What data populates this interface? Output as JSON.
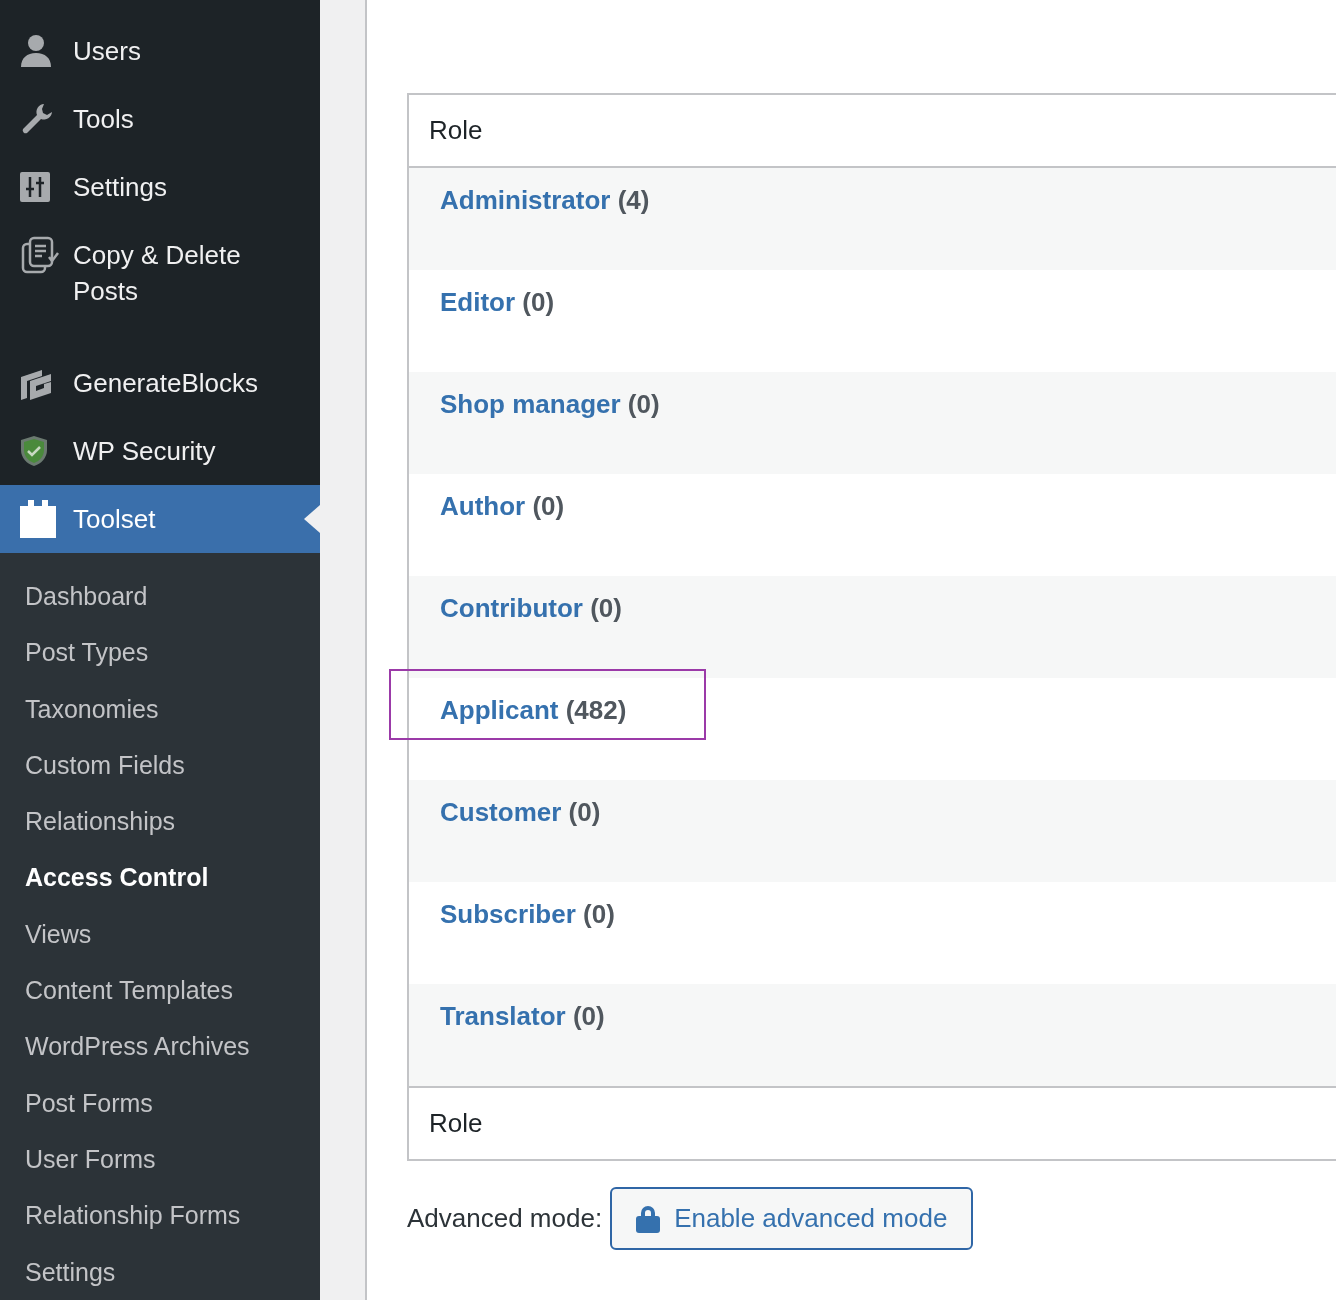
{
  "sidebar": {
    "menu": [
      {
        "label": "Users",
        "selected": false
      },
      {
        "label": "Tools",
        "selected": false
      },
      {
        "label": "Settings",
        "selected": false
      },
      {
        "label": "Copy & Delete Posts",
        "selected": false
      },
      {
        "label": "GenerateBlocks",
        "selected": false
      },
      {
        "label": "WP Security",
        "selected": false
      },
      {
        "label": "Toolset",
        "selected": true
      }
    ],
    "submenu": [
      {
        "label": "Dashboard",
        "selected": false
      },
      {
        "label": "Post Types",
        "selected": false
      },
      {
        "label": "Taxonomies",
        "selected": false
      },
      {
        "label": "Custom Fields",
        "selected": false
      },
      {
        "label": "Relationships",
        "selected": false
      },
      {
        "label": "Access Control",
        "selected": true
      },
      {
        "label": "Views",
        "selected": false
      },
      {
        "label": "Content Templates",
        "selected": false
      },
      {
        "label": "WordPress Archives",
        "selected": false
      },
      {
        "label": "Post Forms",
        "selected": false
      },
      {
        "label": "User Forms",
        "selected": false
      },
      {
        "label": "Relationship Forms",
        "selected": false
      },
      {
        "label": "Settings",
        "selected": false
      }
    ]
  },
  "table": {
    "header": "Role",
    "footer": "Role",
    "rows": [
      {
        "name": "Administrator",
        "count": "(4)",
        "highlighted": false
      },
      {
        "name": "Editor",
        "count": "(0)",
        "highlighted": false
      },
      {
        "name": "Shop manager",
        "count": "(0)",
        "highlighted": false
      },
      {
        "name": "Author",
        "count": "(0)",
        "highlighted": false
      },
      {
        "name": "Contributor",
        "count": "(0)",
        "highlighted": false
      },
      {
        "name": "Applicant",
        "count": "(482)",
        "highlighted": true
      },
      {
        "name": "Customer",
        "count": "(0)",
        "highlighted": false
      },
      {
        "name": "Subscriber",
        "count": "(0)",
        "highlighted": false
      },
      {
        "name": "Translator",
        "count": "(0)",
        "highlighted": false
      }
    ]
  },
  "advanced_mode": {
    "label": "Advanced mode:",
    "button": "Enable advanced mode"
  }
}
